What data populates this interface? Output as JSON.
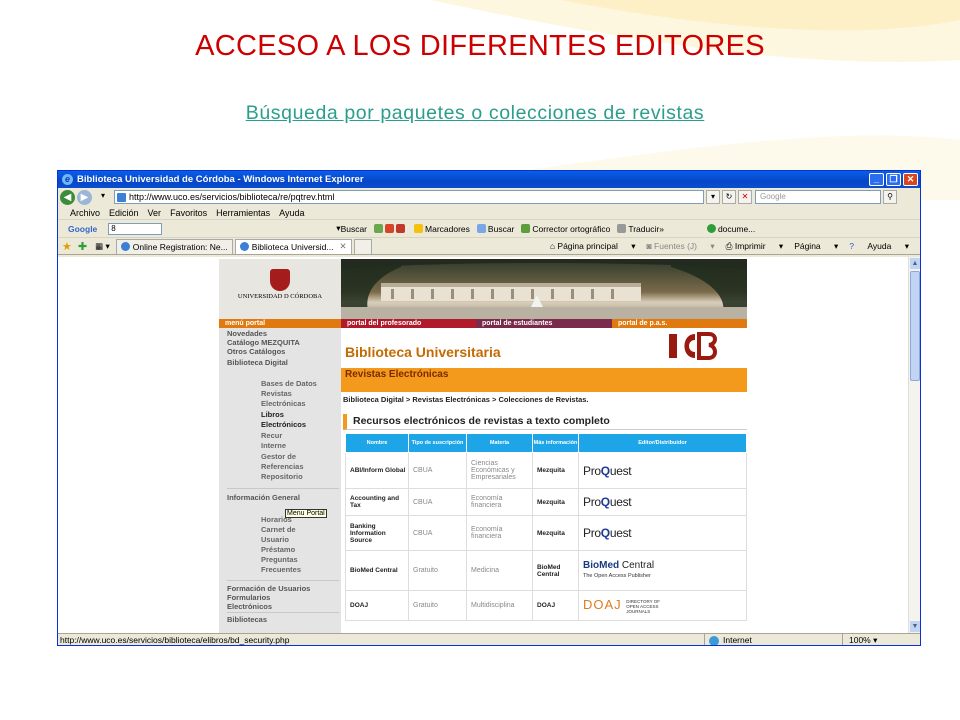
{
  "slide": {
    "title": "ACCESO A LOS DIFERENTES EDITORES",
    "link": "Búsqueda por paquetes o colecciones de revistas",
    "accent": "#cc0000",
    "link_color": "#2a9e8c"
  },
  "browser": {
    "window_title": "Biblioteca Universidad de Córdoba - Windows Internet Explorer",
    "address": "http://www.uco.es/servicios/biblioteca/re/pqtrev.html",
    "search_placeholder": "Google",
    "menu": [
      "Archivo",
      "Edición",
      "Ver",
      "Favoritos",
      "Herramientas",
      "Ayuda"
    ],
    "google_toolbar": {
      "label": "Google",
      "input": "8",
      "buscar": "Buscar",
      "marcadores": "Marcadores",
      "buscar2": "Buscar",
      "corrector": "Corrector ortográfico",
      "traducir": "Traducir",
      "docume": "docume..."
    },
    "tabs": [
      {
        "label": "Online Registration: Ne..."
      },
      {
        "label": "Biblioteca Universid..."
      }
    ],
    "command_bar": {
      "home": "Página principal",
      "feeds": "Fuentes (J)",
      "print": "Imprimir",
      "page": "Página",
      "help": "Ayuda"
    },
    "status_url": "http://www.uco.es/servicios/biblioteca/elibros/bd_security.php",
    "zone": "Internet",
    "zoom": "100%"
  },
  "library": {
    "university": "UNIVERSIDAD D CÓRDOBA",
    "nav": [
      "menú portal",
      "portal del profesorado",
      "portal de estudiantes",
      "portal de p.a.s."
    ],
    "heading": "Biblioteca Universitaria",
    "subheading": "Revistas Electrónicas",
    "breadcrumb": "Biblioteca Digital > Revistas Electrónicas > Colecciones de Revistas.",
    "section_title": "Recursos electrónicos de revistas a texto completo",
    "tooltip": "Menu Portal",
    "menu": {
      "novedades": "Novedades",
      "mezquita": "Catálogo MEZQUITA",
      "otros": "Otros Catálogos",
      "digital": "Biblioteca Digital",
      "bases": "Bases de Datos",
      "revistas": "Revistas",
      "electronicas": "Electrónicas",
      "libros": "Libros",
      "electronicos": "Electrónicos",
      "recursos": "Recur",
      "internet": "Interne",
      "gestor": "Gestor de",
      "referencias": "Referencias",
      "repositorio": "Repositorio",
      "info_general": "Información General",
      "horarios": "Horarios",
      "carnet": "Carnet de",
      "usuario": "Usuario",
      "prestamo": "Préstamo",
      "preguntas": "Preguntas",
      "frecuentes": "Frecuentes",
      "formacion": "Formación de Usuarios",
      "formularios": "Formularios",
      "electronicos2": "Electrónicos",
      "bibliotecas": "Bibliotecas"
    },
    "table_headers": [
      "Nombre",
      "Tipo de suscripción",
      "Materia",
      "Más información",
      "Editor/Distribuidor"
    ],
    "rows": [
      {
        "name": "ABI/Inform Global",
        "type": "CBUA",
        "subject": "Ciencias Económicas y Empresariales",
        "info": "Mezquita",
        "publisher": "ProQuest"
      },
      {
        "name": "Accounting and Tax",
        "type": "CBUA",
        "subject": "Economía financiera",
        "info": "Mezquita",
        "publisher": "ProQuest"
      },
      {
        "name": "Banking Information Source",
        "type": "CBUA",
        "subject": "Economía financiera",
        "info": "Mezquita",
        "publisher": "ProQuest"
      },
      {
        "name": "BioMed Central",
        "type": "Gratuito",
        "subject": "Medicina",
        "info": "BioMed Central",
        "publisher": "BioMed Central"
      },
      {
        "name": "DOAJ",
        "type": "Gratuito",
        "subject": "Multidisciplina",
        "info": "DOAJ",
        "publisher": "DOAJ"
      }
    ],
    "publisher_logos": {
      "proquest_pre": "Pro",
      "proquest_q": "Q",
      "proquest_post": "uest",
      "biomed_a": "BioMed",
      "biomed_b": " Central",
      "biomed_sub": "The Open Access Publisher",
      "doaj": "DOAJ",
      "doaj_small": "DIRECTORY OF OPEN ACCESS JOURNALS"
    },
    "colors": {
      "orange": "#f39a1c",
      "table_header": "#1ea5e8",
      "heading": "#c46a00"
    }
  }
}
